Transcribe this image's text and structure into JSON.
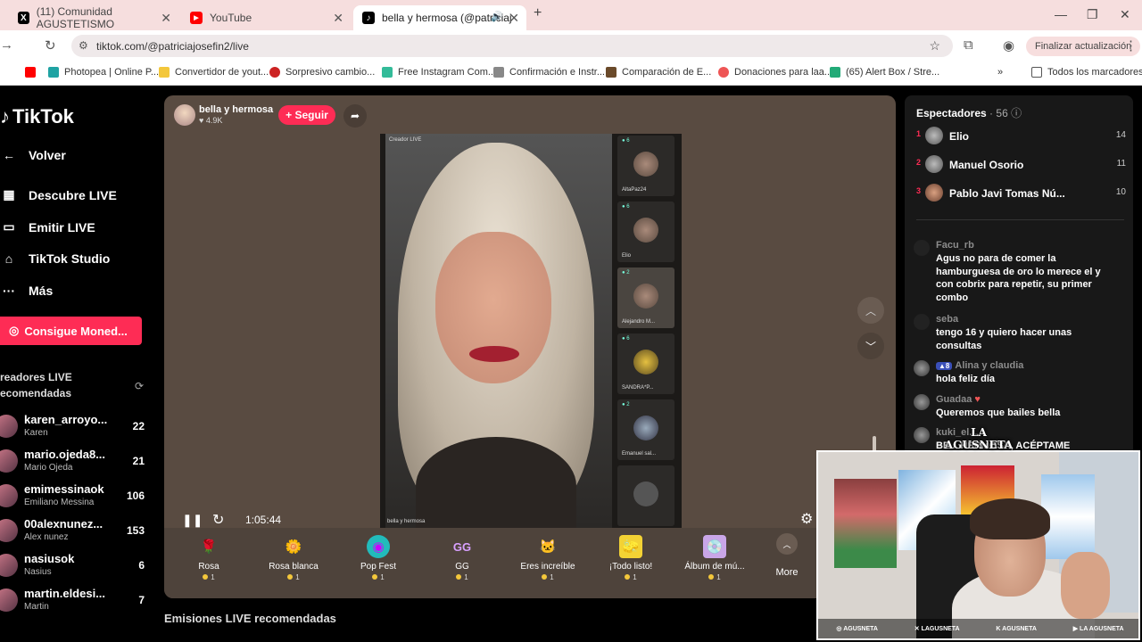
{
  "browser": {
    "tabs": [
      {
        "title": "(11) Comunidad AGUSTETISMO",
        "icon": "x-icon"
      },
      {
        "title": "YouTube",
        "icon": "youtube-icon"
      },
      {
        "title": "bella y hermosa (@patriciaj",
        "icon": "tiktok-icon"
      }
    ],
    "url": "tiktok.com/@patriciajosefin2/live",
    "update_label": "Finalizar actualización",
    "bookmarks": [
      "Photopea | Online P...",
      "Convertidor de yout...",
      "Sorpresivo cambio...",
      "Free Instagram Com...",
      "Confirmación e Instr...",
      "Comparación de E...",
      "Donaciones para laa...",
      "(65) Alert Box / Stre..."
    ],
    "all_bookmarks": "Todos los marcadores"
  },
  "sidebar": {
    "logo": "TikTok",
    "back": "Volver",
    "nav": [
      "Descubre LIVE",
      "Emitir LIVE",
      "TikTok Studio",
      "Más"
    ],
    "coins_button": "Consigue Moned...",
    "recommended_title": "readores LIVE ecomendadas",
    "creators": [
      {
        "name": "karen_arroyo...",
        "sub": "Karen",
        "count": "22"
      },
      {
        "name": "mario.ojeda8...",
        "sub": "Mario Ojeda",
        "count": "21"
      },
      {
        "name": "emimessinaok",
        "sub": "Emiliano Messina",
        "count": "106"
      },
      {
        "name": "00alexnunez...",
        "sub": "Alex nunez",
        "count": "153"
      },
      {
        "name": "nasiusok",
        "sub": "Nasius",
        "count": "6"
      },
      {
        "name": "martin.eldesi...",
        "sub": "Martin",
        "count": "7"
      }
    ]
  },
  "stream": {
    "host_name": "bella y hermosa",
    "host_likes": "4.9K",
    "follow_label": "+ Seguir",
    "video_label": "Creador LIVE",
    "video_name": "bella y hermosa",
    "guests": [
      {
        "name": "AltaPaz24",
        "badge": "6"
      },
      {
        "name": "Elio",
        "badge": "6"
      },
      {
        "name": "Alejandro M...",
        "badge": "2"
      },
      {
        "name": "SANDRA*P...",
        "badge": "6"
      },
      {
        "name": "Emanuel sal...",
        "badge": "2"
      },
      {
        "name": "",
        "badge": ""
      }
    ],
    "time": "1:05:44",
    "gifts": [
      {
        "name": "Rosa",
        "price": "1",
        "icon": "🌹"
      },
      {
        "name": "Rosa blanca",
        "price": "1",
        "icon": "🌼"
      },
      {
        "name": "Pop Fest",
        "price": "1",
        "icon": "◉"
      },
      {
        "name": "GG",
        "price": "1",
        "icon": "GG"
      },
      {
        "name": "Eres increíble",
        "price": "1",
        "icon": "🐱"
      },
      {
        "name": "¡Todo listo!",
        "price": "1",
        "icon": "🧽"
      },
      {
        "name": "Álbum de mú...",
        "price": "1",
        "icon": "💿"
      }
    ],
    "more_label": "More",
    "recommended_live": "Emisiones LIVE recomendadas"
  },
  "spectators": {
    "title": "Espectadores",
    "count": "56",
    "viewers": [
      {
        "rank": "1",
        "name": "Elio",
        "score": "14"
      },
      {
        "rank": "2",
        "name": "Manuel Osorio",
        "score": "11"
      },
      {
        "rank": "3",
        "name": "Pablo Javi Tomas Nú...",
        "score": "10"
      }
    ],
    "comments": [
      {
        "user": "Facu_rb",
        "text": "Agus no para de comer la hamburguesa de oro lo merece el y con cobrix para repetir, su primer combo"
      },
      {
        "user": "seba",
        "text": "tengo 16 y quiero hacer unas consultas"
      },
      {
        "user": "Alina y claudia",
        "badge": "8",
        "text": "hola feliz día"
      },
      {
        "user": "Guadaa",
        "text": "Queremos que bailes bella"
      },
      {
        "user": "kuki_el...",
        "text": "BE... HERMOSA, ACÉPTAME"
      }
    ]
  },
  "webcam": {
    "logo_line1": "LA",
    "logo_line2": "AGUSNETA",
    "socials": [
      "AGUSNETA",
      "LAGUSNETA",
      "AGUSNETA",
      "LA AGUSNETA"
    ]
  }
}
